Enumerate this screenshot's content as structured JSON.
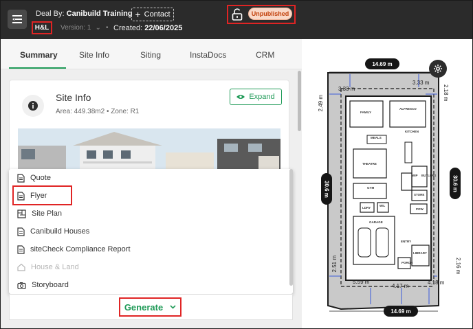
{
  "header": {
    "deal_prefix": "Deal By:",
    "deal_name": "Canibuild Training",
    "contact_label": "Contact",
    "hl_label": "H&L",
    "version_label": "Version: 1",
    "created_prefix": "Created:",
    "created_date": "22/06/2025",
    "status_label": "Unpublished",
    "status_color": "#c2410c"
  },
  "tabs": [
    {
      "label": "Summary",
      "active": true
    },
    {
      "label": "Site Info",
      "active": false
    },
    {
      "label": "Siting",
      "active": false
    },
    {
      "label": "InstaDocs",
      "active": false
    },
    {
      "label": "CRM",
      "active": false
    }
  ],
  "site_info": {
    "title": "Site Info",
    "area": "Area: 449.38m2",
    "zone": "Zone: R1",
    "expand_label": "Expand"
  },
  "menu": {
    "items": [
      {
        "label": "Quote",
        "icon": "document-icon",
        "disabled": false
      },
      {
        "label": "Flyer",
        "icon": "document-icon",
        "disabled": false
      },
      {
        "label": "Site Plan",
        "icon": "site-plan-icon",
        "disabled": false
      },
      {
        "label": "Canibuild Houses",
        "icon": "document-icon",
        "disabled": false
      },
      {
        "label": "siteCheck Compliance Report",
        "icon": "document-icon",
        "disabled": false
      },
      {
        "label": "House & Land",
        "icon": "house-icon",
        "disabled": true
      },
      {
        "label": "Storyboard",
        "icon": "camera-icon",
        "disabled": false
      }
    ]
  },
  "generate_label": "Generate",
  "accent_color": "#1f9a57",
  "site_plan": {
    "top_width": "14.69 m",
    "bottom_width": "14.69 m",
    "left_depth": "30.6 m",
    "right_depth": "30.6 m",
    "setback_top_left": "3.33 m",
    "setback_top_right": "3.33 m",
    "side_top_left": "2.49 m",
    "side_top_right": "2.18 m",
    "side_bottom_left": "2.51 m",
    "side_bottom_right": "2.16 m",
    "rear_left": "5.59 m",
    "rear_mid": "4.17 m",
    "rear_right": "4.18 m",
    "rooms": [
      "FAMILY",
      "ALFRESCO",
      "KITCHEN",
      "MEALS",
      "THEATRE",
      "GYM",
      "WIP",
      "BUTLERS",
      "STORE",
      "LDRY",
      "WIL",
      "POW",
      "GARAGE",
      "ENTRY",
      "PORCH",
      "LIBRARY"
    ]
  }
}
